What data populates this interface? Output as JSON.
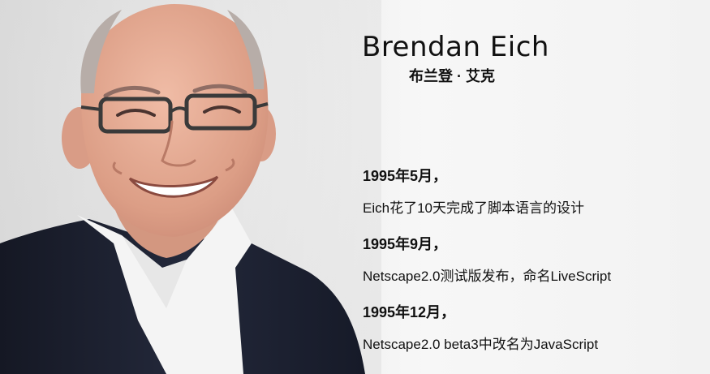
{
  "title": {
    "name_en": "Brendan Eich",
    "name_cn": "布兰登 · 艾克"
  },
  "timeline": [
    {
      "date": "1995年5月，",
      "desc": "Eich花了10天完成了脚本语言的设计"
    },
    {
      "date": "1995年9月，",
      "desc": "Netscape2.0测试版发布，命名LiveScript"
    },
    {
      "date": "1995年12月，",
      "desc": "Netscape2.0 beta3中改名为JavaScript"
    }
  ],
  "colors": {
    "background": "#f2f2f2",
    "text": "#111111",
    "jacket": "#1e2230",
    "shirt": "#f4f4f4",
    "skin": "#e2a78f"
  }
}
